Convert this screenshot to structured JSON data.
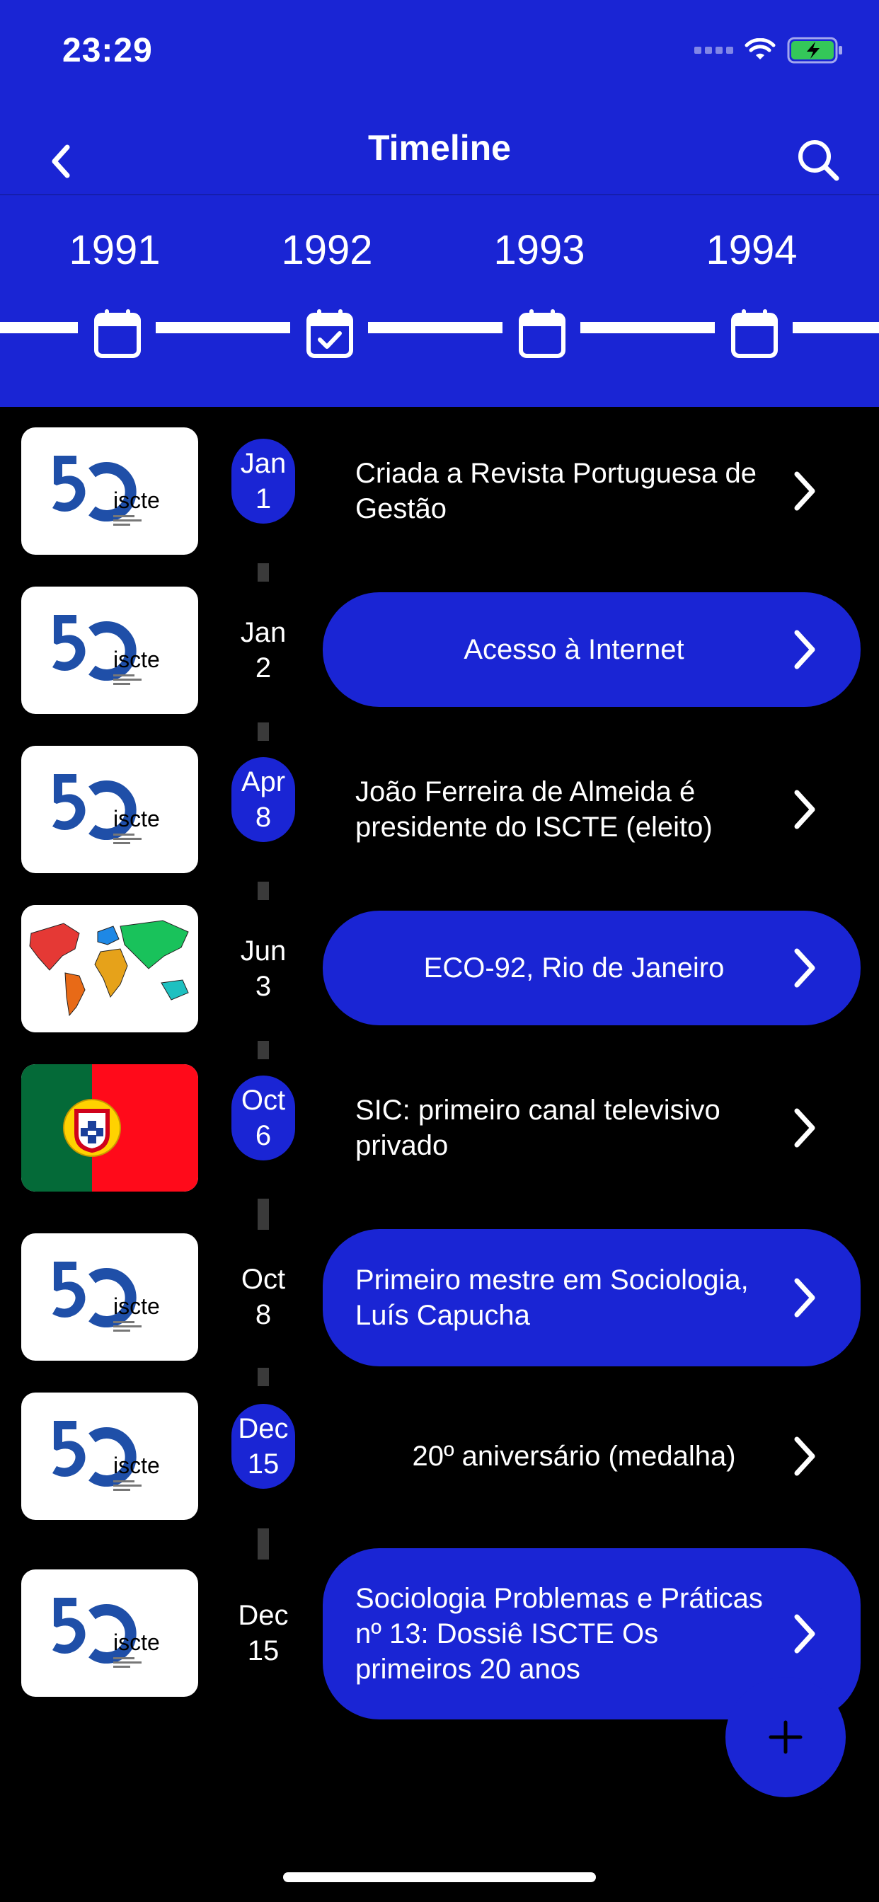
{
  "status": {
    "time": "23:29"
  },
  "nav": {
    "title": "Timeline"
  },
  "years": [
    "1991",
    "1992",
    "1993",
    "1994"
  ],
  "events": [
    {
      "month": "Jan",
      "day": "1",
      "title": "Criada a Revista Portuguesa de Gestão",
      "thumb": "iscte-50-logo",
      "highlight": false
    },
    {
      "month": "Jan",
      "day": "2",
      "title": "Acesso à Internet",
      "thumb": "iscte-50-logo",
      "highlight": true
    },
    {
      "month": "Apr",
      "day": "8",
      "title": "João Ferreira de Almeida é presidente do ISCTE (eleito)",
      "thumb": "iscte-50-logo",
      "highlight": false
    },
    {
      "month": "Jun",
      "day": "3",
      "title": "ECO-92, Rio de Janeiro",
      "thumb": "world-map",
      "highlight": true
    },
    {
      "month": "Oct",
      "day": "6",
      "title": "SIC: primeiro canal televisivo privado",
      "thumb": "portugal-flag",
      "highlight": false
    },
    {
      "month": "Oct",
      "day": "8",
      "title": "Primeiro mestre em Sociologia, Luís Capucha",
      "thumb": "iscte-50-logo",
      "highlight": true
    },
    {
      "month": "Dec",
      "day": "15",
      "title": "20º aniversário (medalha)",
      "thumb": "iscte-50-logo",
      "highlight": false
    },
    {
      "month": "Dec",
      "day": "15",
      "title": "Sociologia Problemas e Práticas nº 13: Dossiê ISCTE Os primeiros 20 anos",
      "thumb": "iscte-50-logo",
      "highlight": true
    }
  ],
  "logo": {
    "text": "iscte"
  },
  "colors": {
    "primary": "#1a25d4",
    "background": "#000000",
    "text": "#ffffff"
  }
}
